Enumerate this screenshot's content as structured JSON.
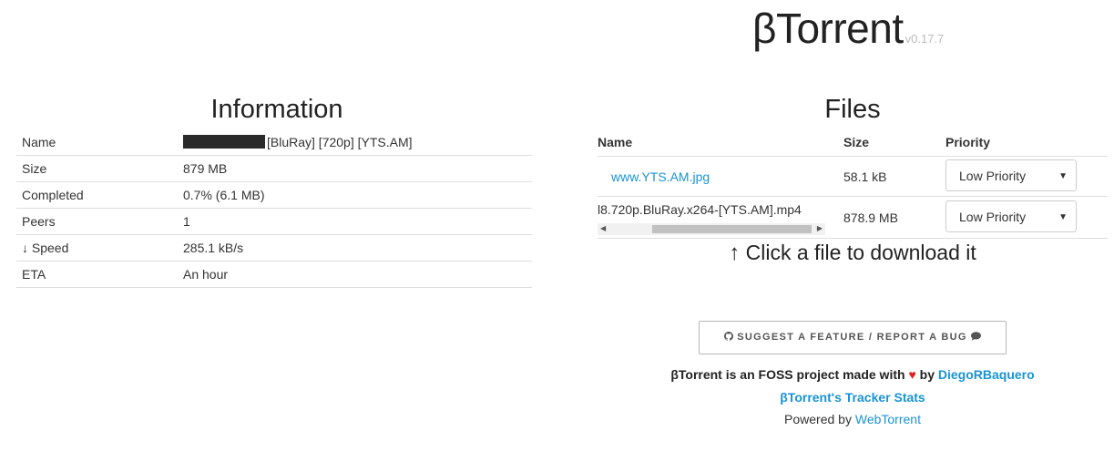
{
  "header": {
    "brand": "βTorrent",
    "version": "v0.17.7"
  },
  "info": {
    "title": "Information",
    "rows": [
      {
        "key": "Name",
        "value": "[BluRay] [720p] [YTS.AM]"
      },
      {
        "key": "Size",
        "value": "879 MB"
      },
      {
        "key": "Completed",
        "value": "0.7% (6.1 MB)"
      },
      {
        "key": "Peers",
        "value": "1"
      },
      {
        "key": "Speed",
        "value": "285.1 kB/s"
      },
      {
        "key": "ETA",
        "value": "An hour"
      }
    ],
    "speed_arrow": "↓"
  },
  "files": {
    "title": "Files",
    "headers": {
      "name": "Name",
      "size": "Size",
      "priority": "Priority"
    },
    "rows": [
      {
        "name": "www.YTS.AM.jpg",
        "size": "58.1 kB",
        "priority": "Low Priority"
      },
      {
        "name": "l8.720p.BluRay.x264-[YTS.AM].mp4",
        "size": "878.9 MB",
        "priority": "Low Priority"
      }
    ]
  },
  "hint": {
    "arrow": "↑",
    "text": "Click a file to download it"
  },
  "footer": {
    "button_label": "SUGGEST A FEATURE / REPORT A BUG",
    "line1_prefix": "βTorrent is an FOSS project made with",
    "heart": "♥",
    "line1_by": "by",
    "author": "DiegoRBaquero",
    "tracker_stats": "βTorrent's Tracker Stats",
    "powered_prefix": "Powered by",
    "powered_link": "WebTorrent"
  },
  "icons": {
    "button_left": "github-icon",
    "button_right": "comment-icon"
  },
  "colors": {
    "link": "#1a93d4",
    "heart": "#e0201e",
    "redaction": "#2a2a2a"
  }
}
